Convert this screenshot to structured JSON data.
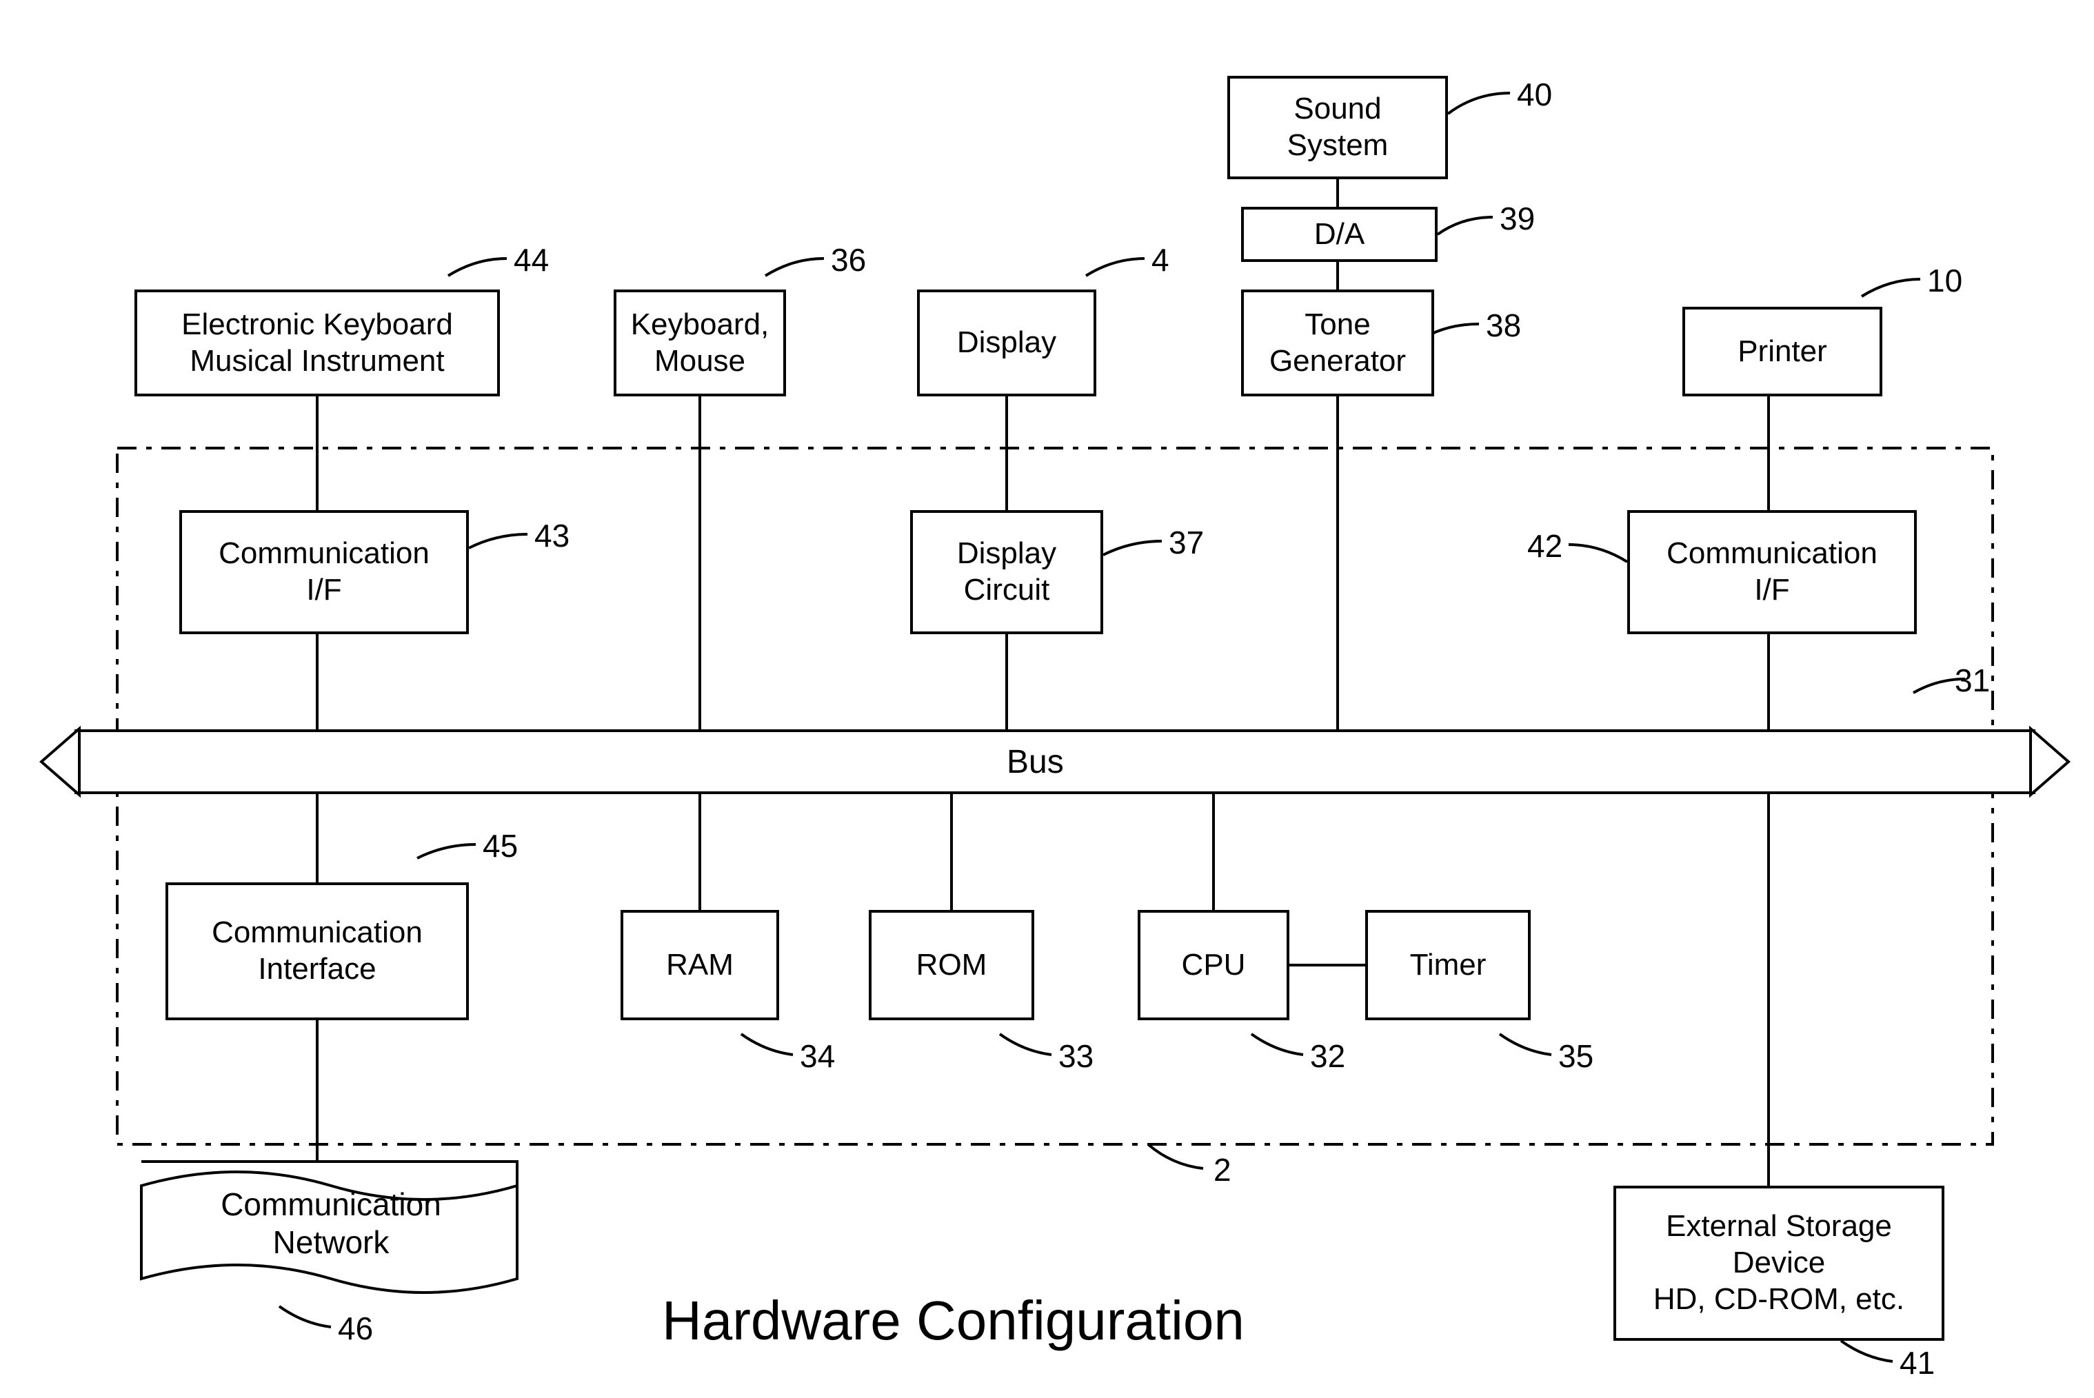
{
  "title": "Hardware Configuration",
  "blocks": {
    "sound_system": {
      "text": "Sound\nSystem",
      "ref": "40"
    },
    "da": {
      "text": "D/A",
      "ref": "39"
    },
    "tone_gen": {
      "text": "Tone\nGenerator",
      "ref": "38"
    },
    "ekmi": {
      "text": "Electronic Keyboard\nMusical Instrument",
      "ref": "44"
    },
    "kb_mouse": {
      "text": "Keyboard,\nMouse",
      "ref": "36"
    },
    "display": {
      "text": "Display",
      "ref": "4"
    },
    "printer": {
      "text": "Printer",
      "ref": "10"
    },
    "comm_if_l": {
      "text": "Communication\nI/F",
      "ref": "43"
    },
    "disp_circ": {
      "text": "Display\nCircuit",
      "ref": "37"
    },
    "comm_if_r": {
      "text": "Communication\nI/F",
      "ref": "42"
    },
    "bus": {
      "text": "Bus",
      "ref": "31"
    },
    "comm_iface": {
      "text": "Communication\nInterface",
      "ref": "45"
    },
    "ram": {
      "text": "RAM",
      "ref": "34"
    },
    "rom": {
      "text": "ROM",
      "ref": "33"
    },
    "cpu": {
      "text": "CPU",
      "ref": "32"
    },
    "timer": {
      "text": "Timer",
      "ref": "35"
    },
    "comm_net": {
      "text": "Communication\nNetwork",
      "ref": "46"
    },
    "ext_storage": {
      "text": "External Storage\nDevice\nHD, CD-ROM, etc.",
      "ref": "41"
    },
    "boundary": {
      "ref": "2"
    }
  }
}
